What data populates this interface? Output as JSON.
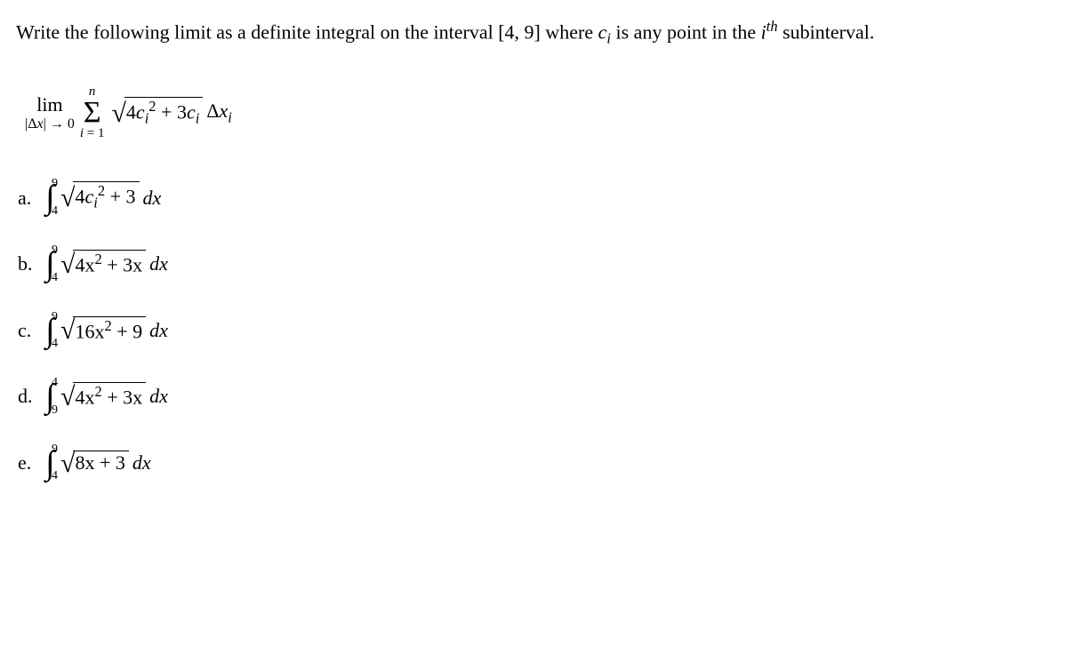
{
  "question": {
    "pre": "Write the following limit as a definite integral on the interval [4, 9] where ",
    "ci_var": "c",
    "ci_sub": "i",
    "mid": " is any point in the ",
    "ith_i": "i",
    "ith_th": "th",
    "post": " subinterval."
  },
  "limit": {
    "lim": "lim",
    "cond_left": "|Δ",
    "cond_x": "x",
    "cond_right": "| → 0",
    "sum_top": "n",
    "sigma": "Σ",
    "sum_bot_left": "i",
    "sum_bot_right": " = 1",
    "rad_a": "4",
    "rad_c": "c",
    "rad_csub": "i",
    "rad_csup": "2",
    "rad_plus": " + 3",
    "rad_c2": "c",
    "rad_c2sub": "i",
    "delta": " Δ",
    "delta_x": "x",
    "delta_sub": "i"
  },
  "options": {
    "a": {
      "label": "a.",
      "upper": "9",
      "lower": "4",
      "body_pre": "4",
      "body_var": "c",
      "body_sub": "i",
      "body_sup": "2",
      "body_post": " + 3",
      "dx": "dx"
    },
    "b": {
      "label": "b.",
      "upper": "9",
      "lower": "4",
      "body": "4x",
      "body_sup": "2",
      "body_post": " + 3x",
      "dx": "dx"
    },
    "c": {
      "label": "c.",
      "upper": "9",
      "lower": "4",
      "body": "16x",
      "body_sup": "2",
      "body_post": " + 9",
      "dx": "dx"
    },
    "d": {
      "label": "d.",
      "upper": "4",
      "lower": "9",
      "body": "4x",
      "body_sup": "2",
      "body_post": " + 3x",
      "dx": "dx"
    },
    "e": {
      "label": "e.",
      "upper": "9",
      "lower": "4",
      "body": "8x + 3",
      "dx": "dx"
    }
  }
}
